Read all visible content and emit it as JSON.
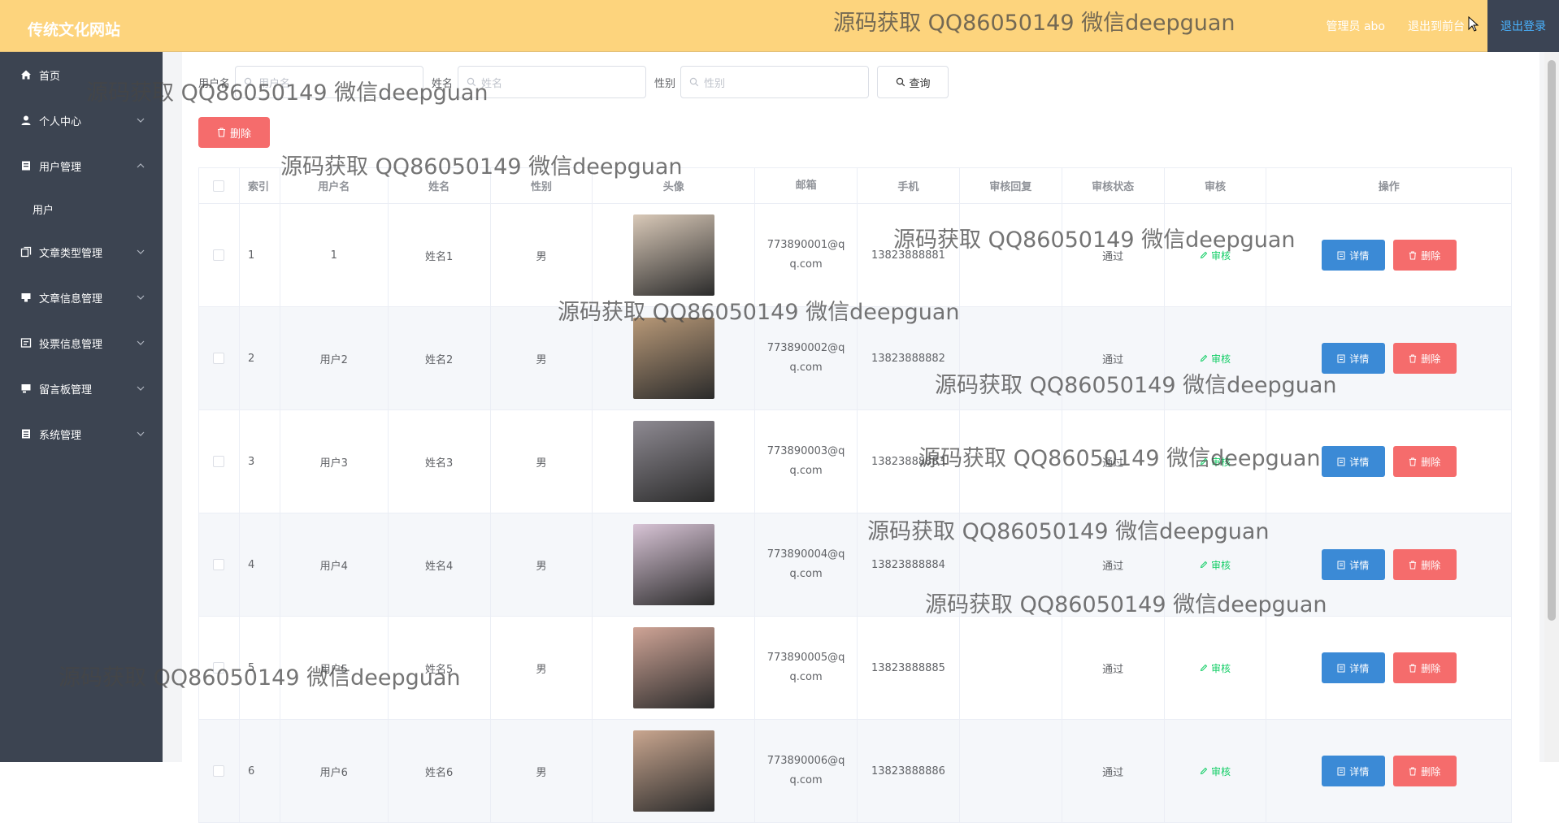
{
  "header": {
    "brand": "传统文化网站",
    "admin_label": "管理员 abo",
    "back_label": "退出到前台",
    "logout_label": "退出登录"
  },
  "sidebar": {
    "items": [
      {
        "label": "首页",
        "icon": "home-icon"
      },
      {
        "label": "个人中心",
        "icon": "user-icon"
      },
      {
        "label": "用户管理",
        "icon": "users-icon",
        "expanded": true
      },
      {
        "label": "文章类型管理",
        "icon": "copy-icon"
      },
      {
        "label": "文章信息管理",
        "icon": "doc-icon"
      },
      {
        "label": "投票信息管理",
        "icon": "vote-icon"
      },
      {
        "label": "留言板管理",
        "icon": "message-icon"
      },
      {
        "label": "系统管理",
        "icon": "settings-icon"
      }
    ],
    "subitems": [
      {
        "label": "用户"
      }
    ]
  },
  "search": {
    "username_label": "用户名",
    "username_placeholder": "用户名",
    "name_label": "姓名",
    "name_placeholder": "姓名",
    "sex_label": "性别",
    "sex_placeholder": "性别",
    "query_label": "查询"
  },
  "toolbar": {
    "delete_label": "删除"
  },
  "table": {
    "columns": [
      "",
      "索引",
      "用户名",
      "姓名",
      "性别",
      "头像",
      "邮箱",
      "手机",
      "审核回复",
      "审核状态",
      "审核",
      "操作"
    ],
    "rows": [
      {
        "index": "1",
        "username": "1",
        "name": "姓名1",
        "sex": "男",
        "email": "773890001@qq.com",
        "phone": "13823888881",
        "reply": "",
        "status": "通过",
        "audit": "审核",
        "avatar_bg": "#d9c9b8"
      },
      {
        "index": "2",
        "username": "用户2",
        "name": "姓名2",
        "sex": "男",
        "email": "773890002@qq.com",
        "phone": "13823888882",
        "reply": "",
        "status": "通过",
        "audit": "审核",
        "avatar_bg": "#b79877"
      },
      {
        "index": "3",
        "username": "用户3",
        "name": "姓名3",
        "sex": "男",
        "email": "773890003@qq.com",
        "phone": "13823888883",
        "reply": "",
        "status": "通过",
        "audit": "审核",
        "avatar_bg": "#8e8a92"
      },
      {
        "index": "4",
        "username": "用户4",
        "name": "姓名4",
        "sex": "男",
        "email": "773890004@qq.com",
        "phone": "13823888884",
        "reply": "",
        "status": "通过",
        "audit": "审核",
        "avatar_bg": "#d8c4d6"
      },
      {
        "index": "5",
        "username": "用户5",
        "name": "姓名5",
        "sex": "男",
        "email": "773890005@qq.com",
        "phone": "13823888885",
        "reply": "",
        "status": "通过",
        "audit": "审核",
        "avatar_bg": "#cfa496"
      },
      {
        "index": "6",
        "username": "用户6",
        "name": "姓名6",
        "sex": "男",
        "email": "773890006@qq.com",
        "phone": "13823888886",
        "reply": "",
        "status": "通过",
        "audit": "审核",
        "avatar_bg": "#c9a68f"
      }
    ],
    "detail_label": "详情",
    "delete_label": "删除"
  },
  "watermark": "源码获取 QQ86050149 微信deepguan",
  "colors": {
    "topbar": "#fdd47d",
    "sidebar": "#3c4451",
    "danger": "#f56c6c",
    "primary": "#3b8ad6",
    "success": "#13ce66"
  }
}
